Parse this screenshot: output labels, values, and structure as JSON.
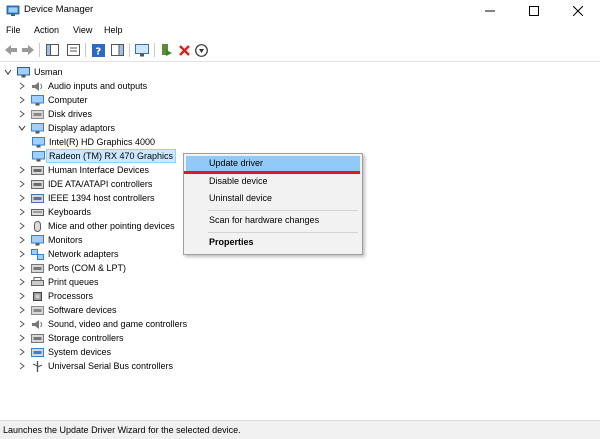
{
  "window": {
    "title": "Device Manager"
  },
  "menubar": [
    "File",
    "Action",
    "View",
    "Help"
  ],
  "toolbar": {
    "buttons": [
      "back-arrow-icon",
      "forward-arrow-icon",
      "console-tree-icon",
      "properties-icon",
      "help-icon",
      "action-pane-icon",
      "monitor-scan-icon",
      "update-driver-icon",
      "uninstall-red-x-icon",
      "download-driver-icon"
    ]
  },
  "tree": {
    "root": "Usman",
    "items": [
      {
        "label": "Audio inputs and outputs",
        "icon": "speaker-icon",
        "expanded": false
      },
      {
        "label": "Computer",
        "icon": "computer-icon",
        "expanded": false
      },
      {
        "label": "Disk drives",
        "icon": "disk-icon",
        "expanded": false
      },
      {
        "label": "Display adaptors",
        "icon": "display-icon",
        "expanded": true
      },
      {
        "label": "Intel(R) HD Graphics 4000",
        "icon": "display-icon",
        "child": true
      },
      {
        "label": "Radeon (TM) RX 470 Graphics",
        "icon": "display-icon",
        "child": true,
        "selected": true
      },
      {
        "label": "Human Interface Devices",
        "icon": "hid-icon",
        "expanded": false
      },
      {
        "label": "IDE ATA/ATAPI controllers",
        "icon": "ide-icon",
        "expanded": false
      },
      {
        "label": "IEEE 1394 host controllers",
        "icon": "ieee-icon",
        "expanded": false
      },
      {
        "label": "Keyboards",
        "icon": "keyboard-icon",
        "expanded": false
      },
      {
        "label": "Mice and other pointing devices",
        "icon": "mouse-icon",
        "expanded": false
      },
      {
        "label": "Monitors",
        "icon": "monitor-icon",
        "expanded": false
      },
      {
        "label": "Network adapters",
        "icon": "network-icon",
        "expanded": false
      },
      {
        "label": "Ports (COM & LPT)",
        "icon": "port-icon",
        "expanded": false
      },
      {
        "label": "Print queues",
        "icon": "printer-icon",
        "expanded": false
      },
      {
        "label": "Processors",
        "icon": "processor-icon",
        "expanded": false
      },
      {
        "label": "Software devices",
        "icon": "software-icon",
        "expanded": false
      },
      {
        "label": "Sound, video and game controllers",
        "icon": "sound-icon",
        "expanded": false
      },
      {
        "label": "Storage controllers",
        "icon": "storage-icon",
        "expanded": false
      },
      {
        "label": "System devices",
        "icon": "system-icon",
        "expanded": false
      },
      {
        "label": "Universal Serial Bus controllers",
        "icon": "usb-icon",
        "expanded": false
      }
    ]
  },
  "context_menu": {
    "update_driver": "Update driver",
    "disable_device": "Disable device",
    "uninstall_device": "Uninstall device",
    "scan_hardware": "Scan for hardware changes",
    "properties": "Properties"
  },
  "status": {
    "text": "Launches the Update Driver Wizard for the selected device."
  },
  "colors": {
    "highlight": "#91c9f7",
    "selection": "#cce8ff",
    "red_underline": "#d61a2a"
  }
}
